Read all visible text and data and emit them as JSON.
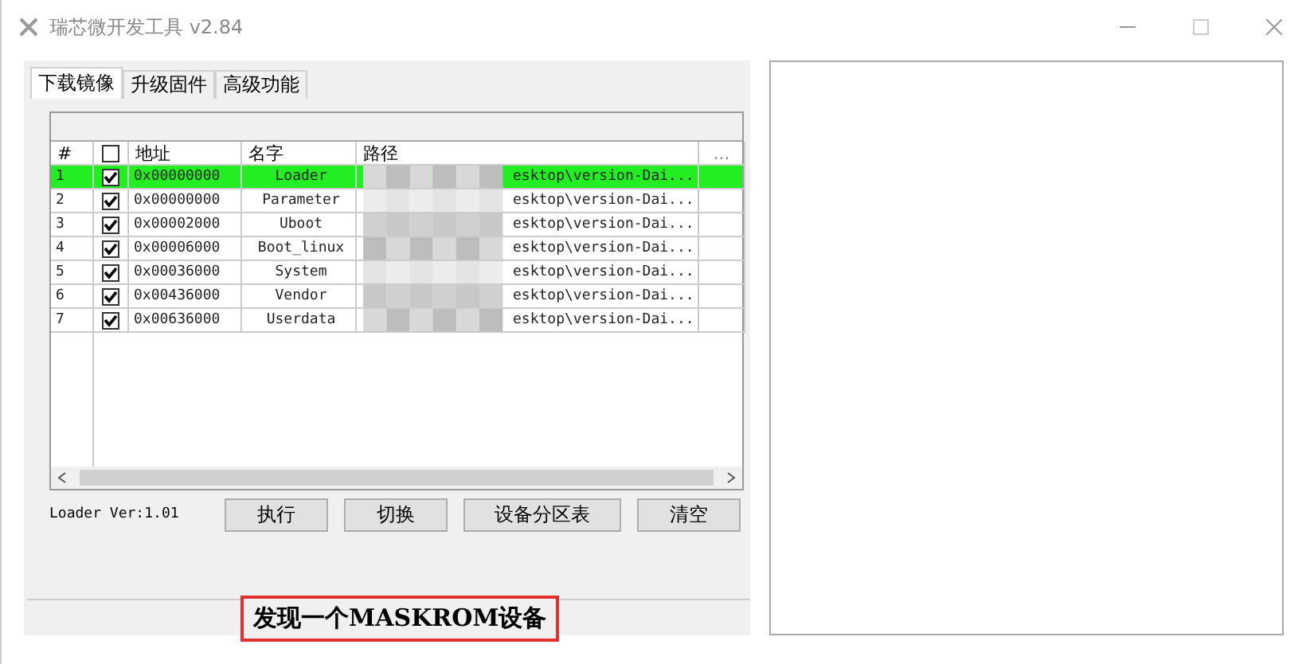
{
  "window": {
    "title": "瑞芯微开发工具 v2.84"
  },
  "tabs": [
    {
      "label": "下载镜像",
      "selected": true
    },
    {
      "label": "升级固件",
      "selected": false
    },
    {
      "label": "高级功能",
      "selected": false
    }
  ],
  "table": {
    "columns": [
      "#",
      "地址",
      "名字",
      "路径",
      "..."
    ],
    "header_checked": false,
    "rows": [
      {
        "index": "1",
        "checked": true,
        "address": "0x00000000",
        "name": "Loader",
        "path": "esktop\\version-Dai...",
        "selected": true
      },
      {
        "index": "2",
        "checked": true,
        "address": "0x00000000",
        "name": "Parameter",
        "path": "esktop\\version-Dai...",
        "selected": false
      },
      {
        "index": "3",
        "checked": true,
        "address": "0x00002000",
        "name": "Uboot",
        "path": "esktop\\version-Dai...",
        "selected": false
      },
      {
        "index": "4",
        "checked": true,
        "address": "0x00006000",
        "name": "Boot_linux",
        "path": "esktop\\version-Dai...",
        "selected": false
      },
      {
        "index": "5",
        "checked": true,
        "address": "0x00036000",
        "name": "System",
        "path": "esktop\\version-Dai...",
        "selected": false
      },
      {
        "index": "6",
        "checked": true,
        "address": "0x00436000",
        "name": "Vendor",
        "path": "esktop\\version-Dai...",
        "selected": false
      },
      {
        "index": "7",
        "checked": true,
        "address": "0x00636000",
        "name": "Userdata",
        "path": "esktop\\version-Dai...",
        "selected": false
      }
    ]
  },
  "loader_version": "Loader Ver:1.01",
  "buttons": [
    "执行",
    "切换",
    "设备分区表",
    "清空"
  ],
  "status_bar": {
    "message": "发现一个MASKROM设备"
  }
}
